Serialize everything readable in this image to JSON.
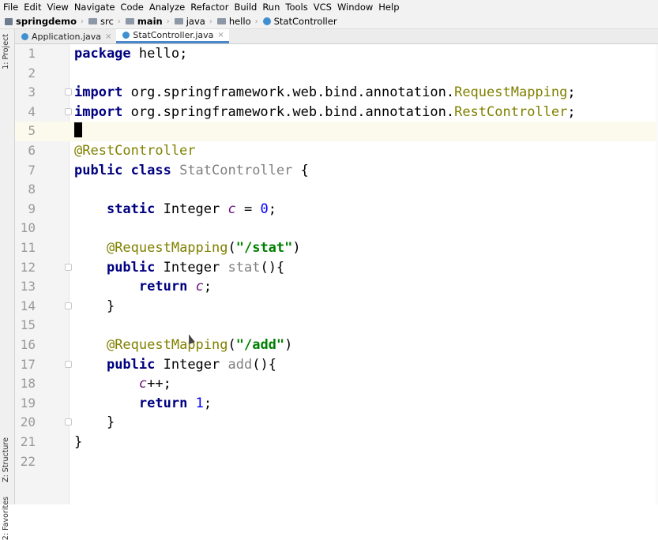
{
  "menubar": {
    "items": [
      "File",
      "Edit",
      "View",
      "Navigate",
      "Code",
      "Analyze",
      "Refactor",
      "Build",
      "Run",
      "Tools",
      "VCS",
      "Window",
      "Help"
    ]
  },
  "navbar": {
    "crumbs": [
      {
        "label": "springdemo",
        "icon": "project-icon",
        "bold": true
      },
      {
        "label": "src",
        "icon": "folder-icon",
        "bold": false
      },
      {
        "label": "main",
        "icon": "folder-icon",
        "bold": true
      },
      {
        "label": "java",
        "icon": "folder-icon",
        "bold": false
      },
      {
        "label": "hello",
        "icon": "package-icon",
        "bold": false
      },
      {
        "label": "StatController",
        "icon": "class-icon",
        "bold": false
      }
    ]
  },
  "leftstrip": {
    "project": "1: Project",
    "structure": "Z: Structure",
    "favorites": "2: Favorites"
  },
  "tabs": [
    {
      "label": "Application.java",
      "active": false,
      "close": "×"
    },
    {
      "label": "StatController.java",
      "active": true,
      "close": "×"
    }
  ],
  "editor": {
    "current_line": 5,
    "lines": [
      {
        "num": "1",
        "tokens": [
          [
            "kw",
            "package"
          ],
          [
            "",
            "hello;"
          ]
        ]
      },
      {
        "num": "2",
        "tokens": []
      },
      {
        "num": "3",
        "tokens": [
          [
            "kw",
            "import"
          ],
          [
            "",
            "org.springframework.web.bind.annotation."
          ],
          [
            "cls",
            "RequestMapping"
          ],
          [
            "",
            ";"
          ]
        ],
        "fold": true
      },
      {
        "num": "4",
        "tokens": [
          [
            "kw",
            "import"
          ],
          [
            "",
            "org.springframework.web.bind.annotation."
          ],
          [
            "cls",
            "RestController"
          ],
          [
            "",
            ";"
          ]
        ],
        "fold": true
      },
      {
        "num": "5",
        "tokens": [
          [
            "caret",
            ""
          ]
        ]
      },
      {
        "num": "6",
        "tokens": [
          [
            "ann",
            "@RestController"
          ]
        ]
      },
      {
        "num": "7",
        "tokens": [
          [
            "kw",
            "public class"
          ],
          [
            "dim",
            "StatController"
          ],
          [
            "",
            " {"
          ]
        ]
      },
      {
        "num": "8",
        "tokens": []
      },
      {
        "num": "9",
        "tokens": [
          [
            "",
            "    "
          ],
          [
            "kw",
            "static"
          ],
          [
            "",
            " Integer "
          ],
          [
            "fld",
            "c"
          ],
          [
            "",
            " = "
          ],
          [
            "num",
            "0"
          ],
          [
            "",
            ";"
          ]
        ]
      },
      {
        "num": "10",
        "tokens": []
      },
      {
        "num": "11",
        "tokens": [
          [
            "",
            "    "
          ],
          [
            "ann",
            "@RequestMapping"
          ],
          [
            "",
            "("
          ],
          [
            "str",
            "\"/stat\""
          ],
          [
            "",
            ")"
          ]
        ]
      },
      {
        "num": "12",
        "tokens": [
          [
            "",
            "    "
          ],
          [
            "kw",
            "public"
          ],
          [
            "",
            " Integer "
          ],
          [
            "dim",
            "stat"
          ],
          [
            "",
            "(){"
          ]
        ],
        "fold": true
      },
      {
        "num": "13",
        "tokens": [
          [
            "",
            "        "
          ],
          [
            "kw",
            "return"
          ],
          [
            "",
            " "
          ],
          [
            "fld",
            "c"
          ],
          [
            "",
            ";"
          ]
        ]
      },
      {
        "num": "14",
        "tokens": [
          [
            "",
            "    }"
          ]
        ],
        "fold": true
      },
      {
        "num": "15",
        "tokens": []
      },
      {
        "num": "16",
        "tokens": [
          [
            "",
            "    "
          ],
          [
            "ann",
            "@RequestMapping"
          ],
          [
            "",
            "("
          ],
          [
            "str",
            "\"/add\""
          ],
          [
            "",
            ")"
          ]
        ]
      },
      {
        "num": "17",
        "tokens": [
          [
            "",
            "    "
          ],
          [
            "kw",
            "public"
          ],
          [
            "",
            " Integer "
          ],
          [
            "dim",
            "add"
          ],
          [
            "",
            "(){"
          ]
        ],
        "fold": true
      },
      {
        "num": "18",
        "tokens": [
          [
            "",
            "        "
          ],
          [
            "fld",
            "c"
          ],
          [
            "",
            "++;"
          ]
        ]
      },
      {
        "num": "19",
        "tokens": [
          [
            "",
            "        "
          ],
          [
            "kw",
            "return"
          ],
          [
            "",
            " "
          ],
          [
            "num",
            "1"
          ],
          [
            "",
            ";"
          ]
        ]
      },
      {
        "num": "20",
        "tokens": [
          [
            "",
            "    }"
          ]
        ],
        "fold": true
      },
      {
        "num": "21",
        "tokens": [
          [
            "",
            "}"
          ]
        ]
      },
      {
        "num": "22",
        "tokens": []
      }
    ]
  }
}
